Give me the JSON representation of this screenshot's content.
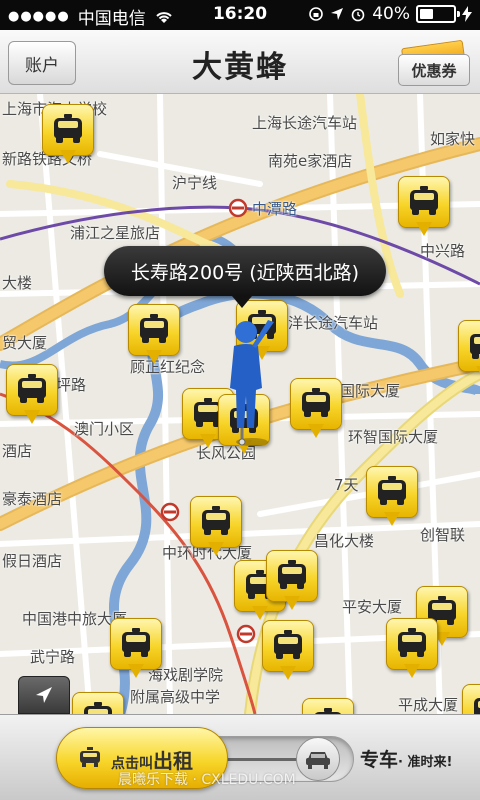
{
  "status_bar": {
    "signal": "●●●●●",
    "carrier": "中国电信",
    "time": "16:20",
    "battery": "40%",
    "battery_level": 0.4
  },
  "nav": {
    "account_label": "账户",
    "title": "大黄蜂",
    "coupon_label": "优惠券"
  },
  "map": {
    "callout": "长寿路200号 (近陕西北路)",
    "pois": [
      {
        "label": "上海市海山学校"
      },
      {
        "label": "上海长途汽车站"
      },
      {
        "label": "如家快"
      },
      {
        "label": "新路铁路文桥"
      },
      {
        "label": "南苑e家酒店"
      },
      {
        "label": "沪宁线"
      },
      {
        "label": "中潭路"
      },
      {
        "label": "浦江之星旅店"
      },
      {
        "label": "中兴路"
      },
      {
        "label": "大楼"
      },
      {
        "label": "洋长途汽车站"
      },
      {
        "label": "贸大厦"
      },
      {
        "label": "顾正红纪念"
      },
      {
        "label": "坪路"
      },
      {
        "label": "国际大厦"
      },
      {
        "label": "澳门小区"
      },
      {
        "label": "环智国际大厦"
      },
      {
        "label": "酒店"
      },
      {
        "label": "长风公园"
      },
      {
        "label": "7天"
      },
      {
        "label": "豪泰酒店"
      },
      {
        "label": "创智联"
      },
      {
        "label": "昌化大楼"
      },
      {
        "label": "假日酒店"
      },
      {
        "label": "中环时代大厦"
      },
      {
        "label": "平安大厦"
      },
      {
        "label": "中国港中旅大厦"
      },
      {
        "label": "武宁路"
      },
      {
        "label": "海戏剧学院"
      },
      {
        "label": "附属高级中学"
      },
      {
        "label": "平成大厦"
      }
    ]
  },
  "bottom": {
    "call_small": "点击叫",
    "call_big": "出租",
    "zhuan_label": "专车",
    "zhuan_sub": "· 准时来!",
    "watermark": "晨曦乐下载 · CXLEDU.COM"
  },
  "colors": {
    "taxi_yellow": "#f7d52a",
    "road_orange": "#f5c86b",
    "road_yellow": "#f7e89a",
    "river": "#7ea6d6",
    "metro_purple": "#6e4aa8",
    "metro_red": "#d9533f",
    "map_bg": "#eceae3"
  }
}
